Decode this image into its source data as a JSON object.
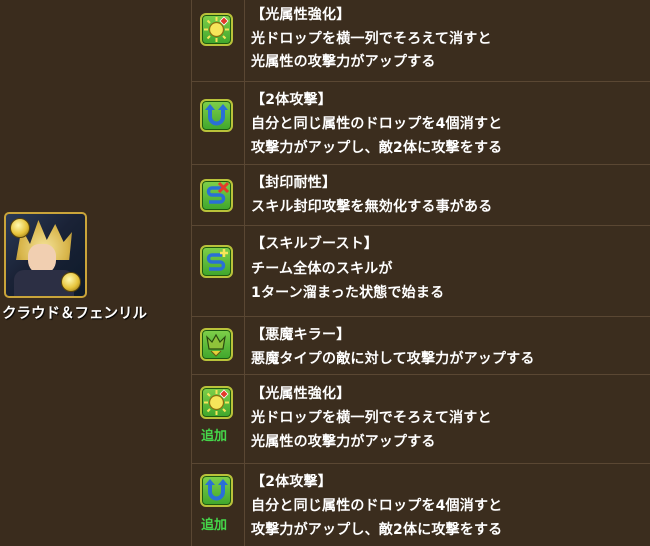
{
  "monster": {
    "name": "クラウド＆フェンリル"
  },
  "awakenings": [
    {
      "icon": "light-attribute-enhance-icon",
      "added_label": "",
      "title": "【光属性強化】",
      "lines": [
        "光ドロップを横一列でそろえて消すと",
        "光属性の攻撃力がアップする"
      ]
    },
    {
      "icon": "two-pronged-attack-icon",
      "added_label": "",
      "title": "【2体攻撃】",
      "lines": [
        "自分と同じ属性のドロップを4個消すと",
        "攻撃力がアップし、敵2体に攻撃をする"
      ]
    },
    {
      "icon": "skill-bind-resist-icon",
      "added_label": "",
      "title": "【封印耐性】",
      "lines": [
        "スキル封印攻撃を無効化する事がある"
      ]
    },
    {
      "icon": "skill-boost-icon",
      "added_label": "",
      "title": "【スキルブースト】",
      "lines": [
        "チーム全体のスキルが",
        "1ターン溜まった状態で始まる"
      ]
    },
    {
      "icon": "devil-killer-icon",
      "added_label": "",
      "title": "【悪魔キラー】",
      "lines": [
        "悪魔タイプの敵に対して攻撃力がアップする"
      ]
    },
    {
      "icon": "light-attribute-enhance-icon",
      "added_label": "追加",
      "title": "【光属性強化】",
      "lines": [
        "光ドロップを横一列でそろえて消すと",
        "光属性の攻撃力がアップする"
      ]
    },
    {
      "icon": "two-pronged-attack-icon",
      "added_label": "追加",
      "title": "【2体攻撃】",
      "lines": [
        "自分と同じ属性のドロップを4個消すと",
        "攻撃力がアップし、敵2体に攻撃をする"
      ]
    }
  ]
}
